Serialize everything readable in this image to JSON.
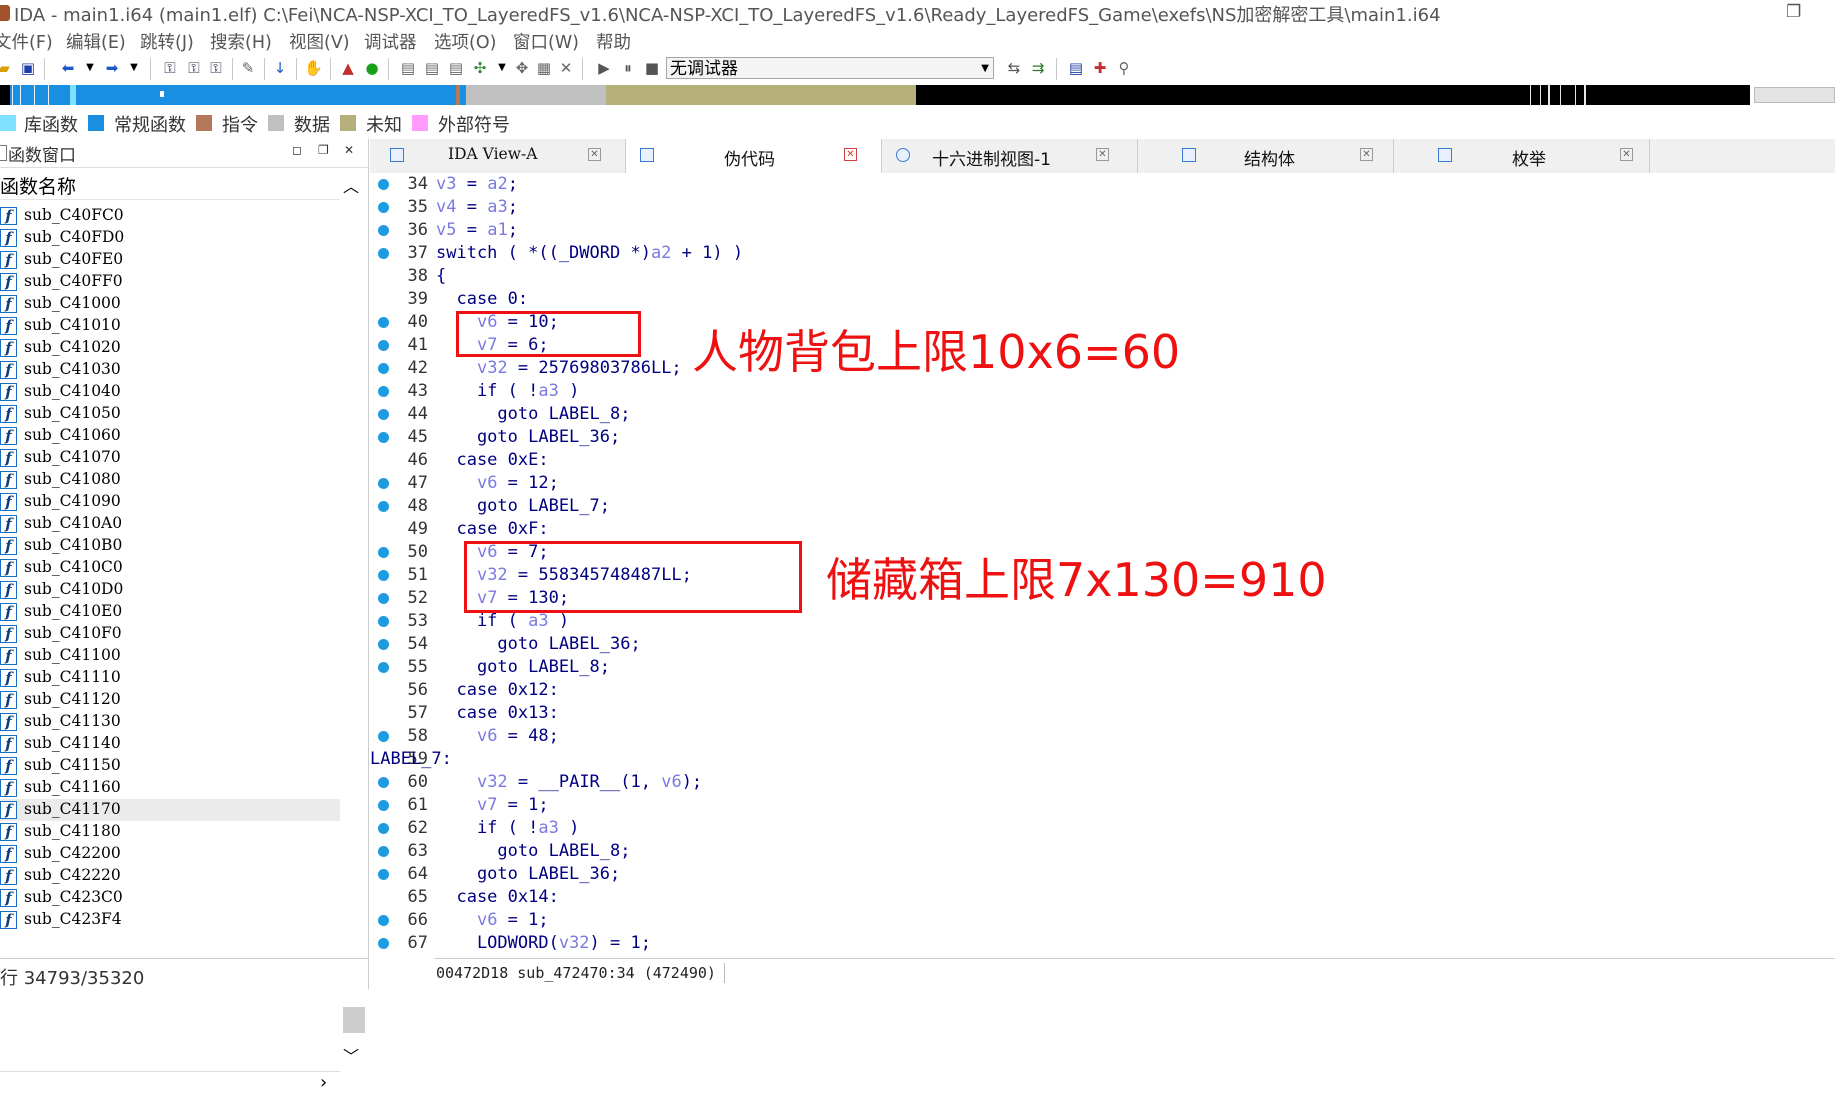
{
  "window": {
    "title": "IDA - main1.i64 (main1.elf) C:\\Fei\\NCA-NSP-XCI_TO_LayeredFS_v1.6\\NCA-NSP-XCI_TO_LayeredFS_v1.6\\Ready_LayeredFS_Game\\exefs\\NS加密解密工具\\main1.i64"
  },
  "menu": [
    "文件(F)",
    "编辑(E)",
    "跳转(J)",
    "搜索(H)",
    "视图(V)",
    "调试器",
    "选项(O)",
    "窗口(W)",
    "帮助"
  ],
  "toolbar": {
    "debugger_label": "无调试器"
  },
  "legend": [
    {
      "label": "库函数",
      "color": "#7fe1ff"
    },
    {
      "label": "常规函数",
      "color": "#1a8ee0"
    },
    {
      "label": "指令",
      "color": "#b5785a"
    },
    {
      "label": "数据",
      "color": "#c0c0c0"
    },
    {
      "label": "未知",
      "color": "#b5b07a"
    },
    {
      "label": "外部符号",
      "color": "#ff9bff"
    }
  ],
  "function_window": {
    "title": "函数窗口",
    "column": "函数名称",
    "functions": [
      "sub_C40FC0",
      "sub_C40FD0",
      "sub_C40FE0",
      "sub_C40FF0",
      "sub_C41000",
      "sub_C41010",
      "sub_C41020",
      "sub_C41030",
      "sub_C41040",
      "sub_C41050",
      "sub_C41060",
      "sub_C41070",
      "sub_C41080",
      "sub_C41090",
      "sub_C410A0",
      "sub_C410B0",
      "sub_C410C0",
      "sub_C410D0",
      "sub_C410E0",
      "sub_C410F0",
      "sub_C41100",
      "sub_C41110",
      "sub_C41120",
      "sub_C41130",
      "sub_C41140",
      "sub_C41150",
      "sub_C41160",
      "sub_C41170",
      "sub_C41180",
      "sub_C42200",
      "sub_C42220",
      "sub_C423C0",
      "sub_C423F4"
    ],
    "selected_index": 27,
    "line_status": "行 34793/35320"
  },
  "tabs": [
    {
      "label": "IDA View-A",
      "active": false
    },
    {
      "label": "伪代码",
      "active": true
    },
    {
      "label": "十六进制视图-1",
      "active": false
    },
    {
      "label": "结构体",
      "active": false
    },
    {
      "label": "枚举",
      "active": false
    }
  ],
  "code_lines": [
    {
      "n": "34",
      "bp": true,
      "text": "v3 = a2;"
    },
    {
      "n": "35",
      "bp": true,
      "text": "v4 = a3;"
    },
    {
      "n": "36",
      "bp": true,
      "text": "v5 = a1;"
    },
    {
      "n": "37",
      "bp": true,
      "text": "switch ( *((_DWORD *)a2 + 1) )"
    },
    {
      "n": "38",
      "bp": false,
      "text": "{"
    },
    {
      "n": "39",
      "bp": false,
      "text": "  case 0:"
    },
    {
      "n": "40",
      "bp": true,
      "text": "    v6 = 10;"
    },
    {
      "n": "41",
      "bp": true,
      "text": "    v7 = 6;"
    },
    {
      "n": "42",
      "bp": true,
      "text": "    v32 = 25769803786LL;"
    },
    {
      "n": "43",
      "bp": true,
      "text": "    if ( !a3 )"
    },
    {
      "n": "44",
      "bp": true,
      "text": "      goto LABEL_8;"
    },
    {
      "n": "45",
      "bp": true,
      "text": "    goto LABEL_36;"
    },
    {
      "n": "46",
      "bp": false,
      "text": "  case 0xE:"
    },
    {
      "n": "47",
      "bp": true,
      "text": "    v6 = 12;"
    },
    {
      "n": "48",
      "bp": true,
      "text": "    goto LABEL_7;"
    },
    {
      "n": "49",
      "bp": false,
      "text": "  case 0xF:"
    },
    {
      "n": "50",
      "bp": true,
      "text": "    v6 = 7;"
    },
    {
      "n": "51",
      "bp": true,
      "text": "    v32 = 558345748487LL;"
    },
    {
      "n": "52",
      "bp": true,
      "text": "    v7 = 130;"
    },
    {
      "n": "53",
      "bp": true,
      "text": "    if ( a3 )"
    },
    {
      "n": "54",
      "bp": true,
      "text": "      goto LABEL_36;"
    },
    {
      "n": "55",
      "bp": true,
      "text": "    goto LABEL_8;"
    },
    {
      "n": "56",
      "bp": false,
      "text": "  case 0x12:"
    },
    {
      "n": "57",
      "bp": false,
      "text": "  case 0x13:"
    },
    {
      "n": "58",
      "bp": true,
      "text": "    v6 = 48;"
    },
    {
      "n": "59",
      "bp": false,
      "text": "LABEL_7:"
    },
    {
      "n": "60",
      "bp": true,
      "text": "    v32 = __PAIR__(1, v6);"
    },
    {
      "n": "61",
      "bp": true,
      "text": "    v7 = 1;"
    },
    {
      "n": "62",
      "bp": true,
      "text": "    if ( !a3 )"
    },
    {
      "n": "63",
      "bp": true,
      "text": "      goto LABEL_8;"
    },
    {
      "n": "64",
      "bp": true,
      "text": "    goto LABEL_36;"
    },
    {
      "n": "65",
      "bp": false,
      "text": "  case 0x14:"
    },
    {
      "n": "66",
      "bp": true,
      "text": "    v6 = 1;"
    },
    {
      "n": "67",
      "bp": true,
      "text": "    LODWORD(v32) = 1;"
    }
  ],
  "annotations": {
    "backpack": "人物背包上限10x6=60",
    "storage": "储藏箱上限7x130=910"
  },
  "status": {
    "code": "00472D18 sub_472470:34 (472490)"
  }
}
